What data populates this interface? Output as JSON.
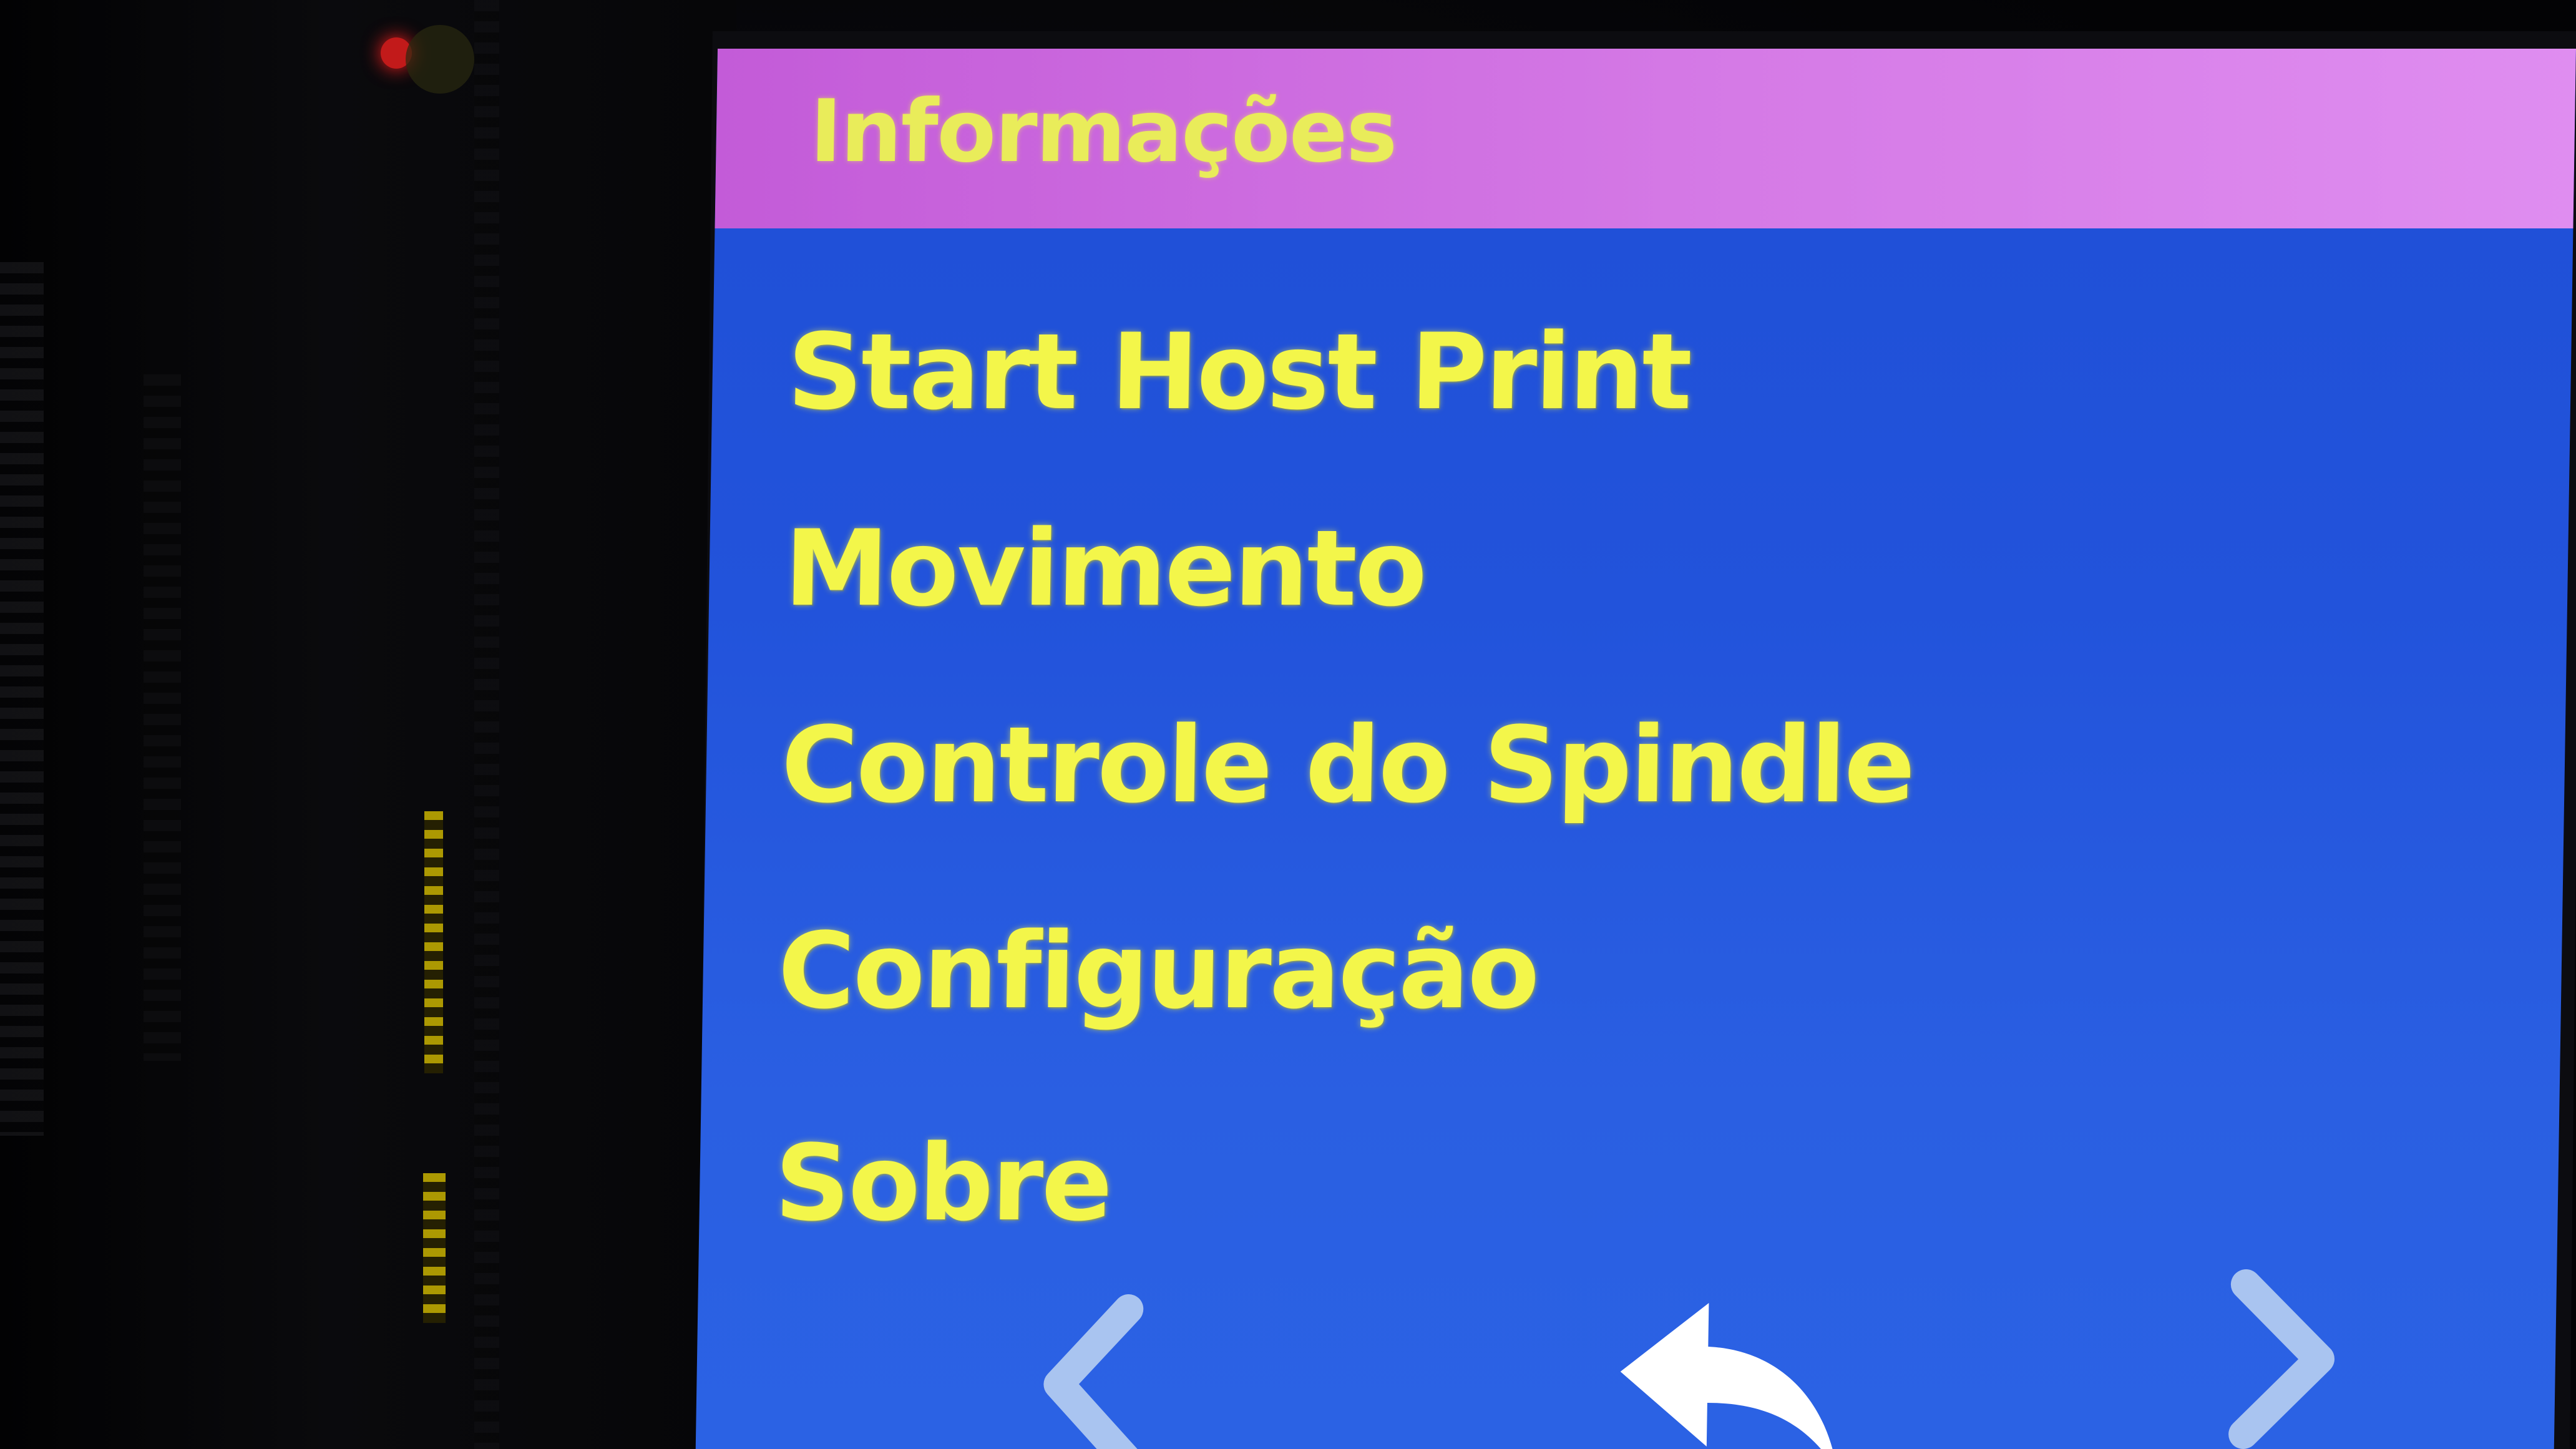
{
  "screen": {
    "title": "Informações",
    "menu_items": [
      {
        "label": "Start Host Print"
      },
      {
        "label": "Movimento"
      },
      {
        "label": "Controle do Spindle"
      },
      {
        "label": "Configuração"
      },
      {
        "label": "Sobre"
      }
    ],
    "nav": {
      "prev_icon": "chevron-left-icon",
      "back_icon": "back-arrow-icon",
      "next_icon": "chevron-right-icon"
    }
  },
  "colors": {
    "header_bg": "#d57ae6",
    "screen_bg": "#2253db",
    "text": "#f3f64a",
    "nav_icon": "#a9c4f0",
    "back_icon": "#ffffff"
  }
}
